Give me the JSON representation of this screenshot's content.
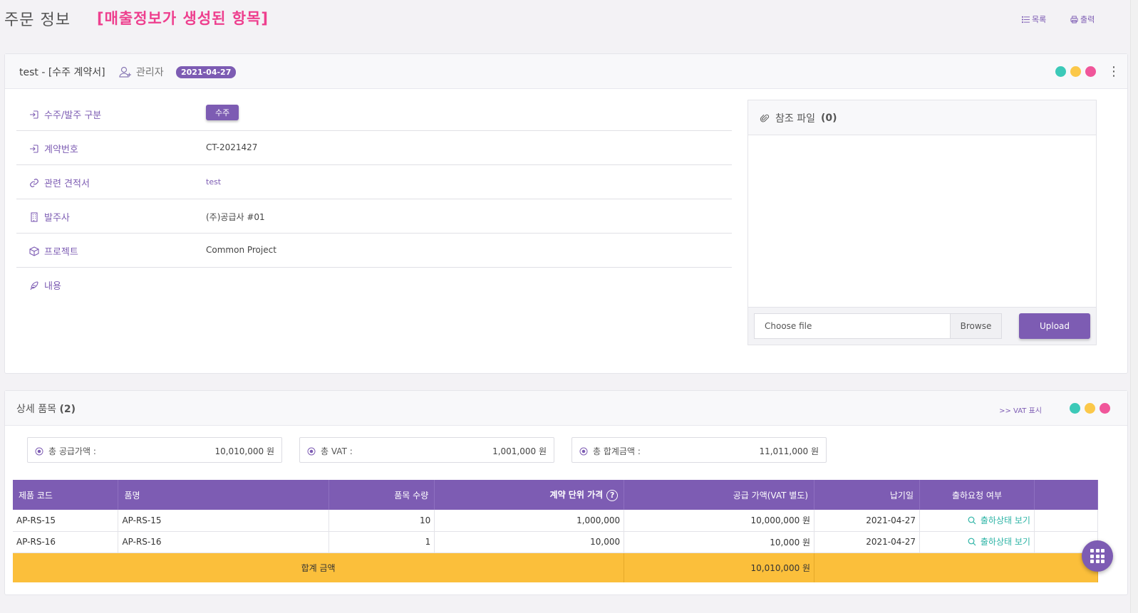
{
  "header": {
    "title": "주문 정보",
    "subtitle": "[매출정보가 생성된 항목]",
    "list_link": "목록",
    "print_link": "출력"
  },
  "colors": {
    "accent": "#7d5cb3",
    "highlight": "#ee3f8e",
    "total_row": "#fbbf3b",
    "dot_teal": "#3cc9b8",
    "dot_yellow": "#fbc84a",
    "dot_pink": "#f0569a"
  },
  "order_card": {
    "title": "test - [수주 계약서]",
    "user": "관리자",
    "date": "2021-04-27",
    "fields": [
      {
        "icon": "sign-in-icon",
        "label": "수주/발주 구분",
        "tag": "수주"
      },
      {
        "icon": "sign-in-icon",
        "label": "계약번호",
        "value": "CT-2021427"
      },
      {
        "icon": "link-icon",
        "label": "관련 견적서",
        "link": "test"
      },
      {
        "icon": "building-icon",
        "label": "발주사",
        "value": "(주)공급사 #01"
      },
      {
        "icon": "box-icon",
        "label": "프로젝트",
        "value": "Common Project"
      },
      {
        "icon": "feather-icon",
        "label": "내용",
        "value": ""
      }
    ],
    "files": {
      "title": "참조 파일",
      "count": "(0)",
      "placeholder": "Choose file",
      "browse": "Browse",
      "upload": "Upload"
    }
  },
  "items_card": {
    "title": "상세 품목",
    "count": "(2)",
    "vat_toggle": ">> VAT 표시",
    "summary": [
      {
        "label": "총 공급가액 :",
        "value": "10,010,000 원"
      },
      {
        "label": "총 VAT :",
        "value": "1,001,000 원"
      },
      {
        "label": "총 합계금액 :",
        "value": "11,011,000 원"
      }
    ],
    "columns": [
      "제품 코드",
      "품명",
      "품목 수량",
      "계약 단위 가격",
      "공급 가액(VAT 별도)",
      "납기일",
      "출하요청 여부"
    ],
    "rows": [
      {
        "code": "AP-RS-15",
        "name": "AP-RS-15",
        "qty": "10",
        "unit_price": "1,000,000",
        "supply": "10,000,000 원",
        "due": "2021-04-27",
        "ship": "출하상태 보기"
      },
      {
        "code": "AP-RS-16",
        "name": "AP-RS-16",
        "qty": "1",
        "unit_price": "10,000",
        "supply": "10,000 원",
        "due": "2021-04-27",
        "ship": "출하상태 보기"
      }
    ],
    "total_label": "합계 금액",
    "total_value": "10,010,000 원"
  }
}
